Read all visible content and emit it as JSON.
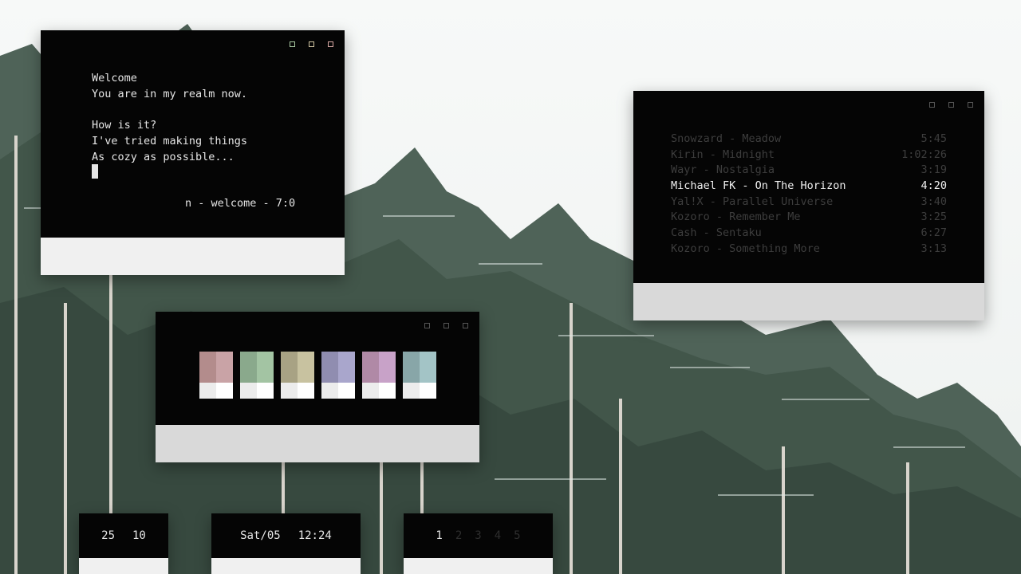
{
  "terminal": {
    "lines": [
      "Welcome",
      "You are in my realm now.",
      "",
      "How is it?",
      "I've tried making things",
      "As cozy as possible..."
    ],
    "status": "n - welcome - 7:0"
  },
  "music": {
    "tracks": [
      {
        "title": "Snowzard - Meadow",
        "duration": "5:45"
      },
      {
        "title": "Kirin - Midnight",
        "duration": "1:02:26"
      },
      {
        "title": "Wayr - Nostalgia",
        "duration": "3:19"
      },
      {
        "title": "Michael FK - On The Horizon",
        "duration": "4:20",
        "active": true
      },
      {
        "title": "Yal!X - Parallel Universe",
        "duration": "3:40"
      },
      {
        "title": "Kozoro - Remember Me",
        "duration": "3:25"
      },
      {
        "title": "Cash - Sentaku",
        "duration": "6:27"
      },
      {
        "title": "Kozoro - Something More",
        "duration": "3:13"
      }
    ]
  },
  "palette": {
    "swatches": [
      {
        "dark": "#b38c8c",
        "light": "#c9a3a6"
      },
      {
        "dark": "#8aa98c",
        "light": "#a3c4a3"
      },
      {
        "dark": "#a8a284",
        "light": "#c8c2a0"
      },
      {
        "dark": "#908db0",
        "light": "#a9a6cc"
      },
      {
        "dark": "#b089a6",
        "light": "#c8a2c8"
      },
      {
        "dark": "#88a6a8",
        "light": "#a3c4c6"
      }
    ]
  },
  "bars": {
    "stats": {
      "a": "25",
      "b": "10"
    },
    "clock": {
      "date": "Sat/05",
      "time": "12:24"
    },
    "workspaces": {
      "items": [
        "1",
        "2",
        "3",
        "4",
        "5"
      ],
      "active": "1"
    }
  }
}
